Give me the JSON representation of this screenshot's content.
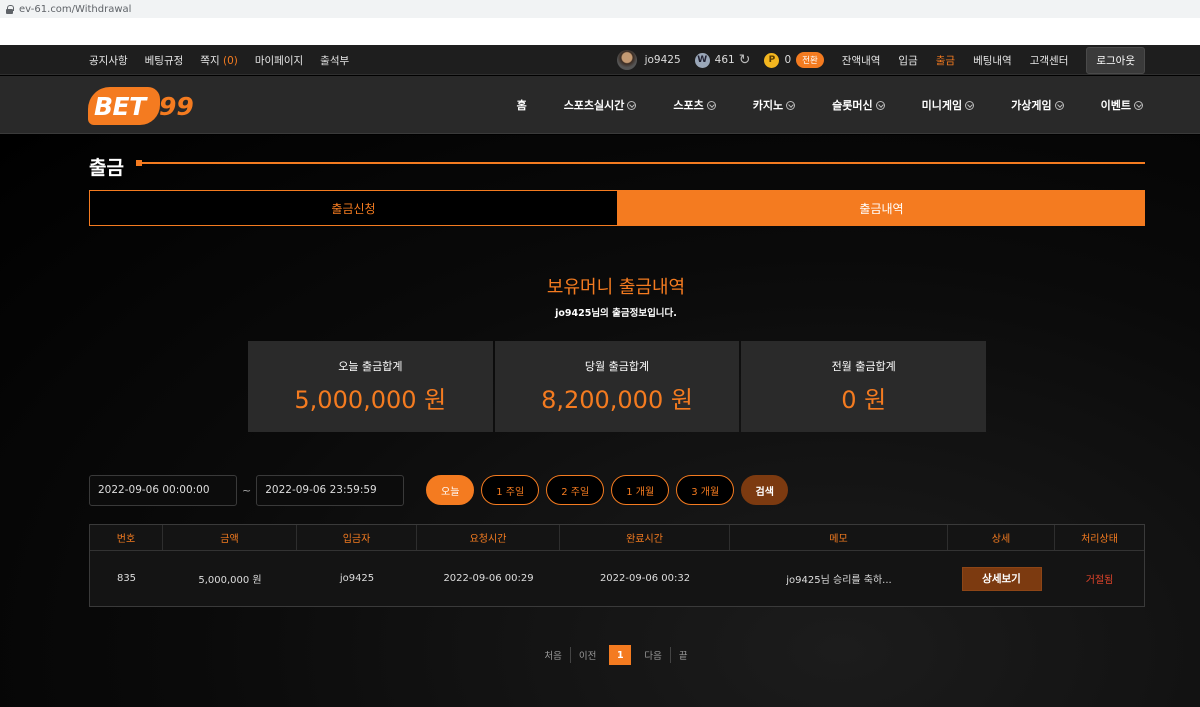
{
  "browser": {
    "url": "ev-61.com/Withdrawal"
  },
  "topbar": {
    "left_links": [
      "공지사항",
      "베팅규정",
      "쪽지",
      "마이페이지",
      "출석부"
    ],
    "message_count_open": "(",
    "message_count": "0",
    "message_count_close": ")",
    "username": "jo9425",
    "w_badge": "W",
    "w_balance": "461",
    "refresh_icon": "↻",
    "p_badge": "P",
    "p_balance": "0",
    "convert_label": "전환",
    "right_links": [
      "잔액내역",
      "입금",
      "출금",
      "베팅내역",
      "고객센터"
    ],
    "active_link": "출금",
    "logout_label": "로그아웃"
  },
  "logo": {
    "part1": "BET",
    "part2": "99"
  },
  "nav": [
    "홈",
    "스포츠실시간",
    "스포츠",
    "카지노",
    "슬롯머신",
    "미니게임",
    "가상게임",
    "이벤트"
  ],
  "page": {
    "title": "출금",
    "tabs": [
      "출금신청",
      "출금내역"
    ],
    "active_tab": "출금내역",
    "section_title": "보유머니 출금내역",
    "section_subtitle": "jo9425님의 출금정보입니다."
  },
  "stats": [
    {
      "label": "오늘 출금합계",
      "value": "5,000,000 원"
    },
    {
      "label": "당월 출금합계",
      "value": "8,200,000 원"
    },
    {
      "label": "전월 출금합계",
      "value": "0 원"
    }
  ],
  "filter": {
    "start": "2022-09-06 00:00:00",
    "separator": "~",
    "end": "2022-09-06 23:59:59",
    "ranges": [
      "오늘",
      "1 주일",
      "2 주일",
      "1 개월",
      "3 개월"
    ],
    "search_label": "검색"
  },
  "table": {
    "headers": [
      "번호",
      "금액",
      "입금자",
      "요청시간",
      "완료시간",
      "메모",
      "상세",
      "처리상태"
    ],
    "rows": [
      {
        "no": "835",
        "amount": "5,000,000 원",
        "depositor": "jo9425",
        "requested": "2022-09-06 00:29",
        "completed": "2022-09-06 00:32",
        "memo": "jo9425님 승리를 축하...",
        "detail_label": "상세보기",
        "status": "거절됨"
      }
    ]
  },
  "pagination": {
    "first": "처음",
    "prev": "이전",
    "current": "1",
    "next": "다음",
    "last": "끝"
  },
  "colors": {
    "accent": "#f47b20",
    "dark_accent": "#7c3a10",
    "rejected": "#e0442a"
  }
}
